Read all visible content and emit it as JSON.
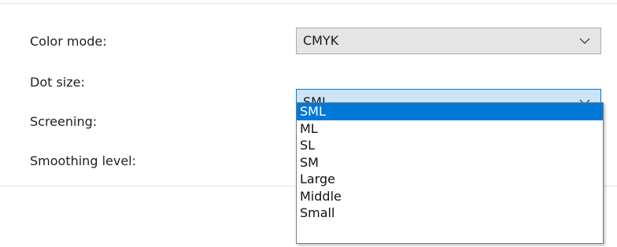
{
  "fields": {
    "color_mode": {
      "label": "Color mode:",
      "value": "CMYK"
    },
    "dot_size": {
      "label": "Dot size:",
      "value": "SML",
      "options": [
        "SML",
        "ML",
        "SL",
        "SM",
        "Large",
        "Middle",
        "Small"
      ],
      "selected_index": 0
    },
    "screening": {
      "label": "Screening:"
    },
    "smoothing_level": {
      "label": "Smoothing level:"
    }
  },
  "icons": {
    "combo_arrow": "chevron-down-icon"
  },
  "colors": {
    "accent": "#0078d7",
    "focus_fill": "#cce4f7",
    "combo_fill": "#e5e5e5"
  }
}
